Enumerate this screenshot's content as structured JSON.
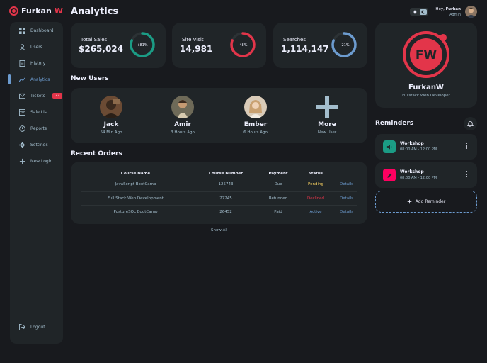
{
  "brand": {
    "name": "Furkan",
    "accent": "W"
  },
  "sidebar": {
    "items": [
      {
        "label": "Dashboard",
        "icon": "grid-icon"
      },
      {
        "label": "Users",
        "icon": "user-icon"
      },
      {
        "label": "History",
        "icon": "receipt-icon"
      },
      {
        "label": "Analytics",
        "icon": "chart-icon",
        "active": true
      },
      {
        "label": "Tickets",
        "icon": "mail-icon",
        "badge": "27"
      },
      {
        "label": "Sale List",
        "icon": "inventory-icon"
      },
      {
        "label": "Reports",
        "icon": "report-icon"
      },
      {
        "label": "Settings",
        "icon": "gear-icon"
      },
      {
        "label": "New Login",
        "icon": "plus-icon"
      }
    ],
    "logout": "Logout"
  },
  "page": {
    "title": "Analytics"
  },
  "stats": [
    {
      "label": "Total Sales",
      "value": "$265,024",
      "percent_label": "+81%",
      "percent": 81,
      "color": "#1b9c85"
    },
    {
      "label": "Site Visit",
      "value": "14,981",
      "percent_label": "-48%",
      "percent": 81,
      "color": "#e3354a"
    },
    {
      "label": "Searches",
      "value": "1,114,147",
      "percent_label": "+21%",
      "percent": 81,
      "color": "#6c9bcf"
    }
  ],
  "new_users": {
    "title": "New Users",
    "users": [
      {
        "name": "Jack",
        "time": "54 Min Ago"
      },
      {
        "name": "Amir",
        "time": "3 Hours Ago"
      },
      {
        "name": "Ember",
        "time": "6 Hours Ago"
      },
      {
        "name": "More",
        "time": "New User"
      }
    ]
  },
  "orders": {
    "title": "Recent Orders",
    "headers": [
      "Course Name",
      "Course Number",
      "Payment",
      "Status"
    ],
    "rows": [
      {
        "name": "JavaScript BootCamp",
        "number": "125743",
        "payment": "Due",
        "status": "Pending",
        "action": "Details"
      },
      {
        "name": "Full Stack Web Development",
        "number": "27245",
        "payment": "Refunded",
        "status": "Declined",
        "action": "Details"
      },
      {
        "name": "PostgreSQL BootCamp",
        "number": "26452",
        "payment": "Paid",
        "status": "Active",
        "action": "Details"
      }
    ],
    "show_all": "Show All"
  },
  "header": {
    "greeting": "Hey,",
    "user": "Furkan",
    "role": "Admin"
  },
  "profile": {
    "logo_text": "FW",
    "name": "FurkanW",
    "role": "Fullstack Web Developer"
  },
  "reminders": {
    "title": "Reminders",
    "items": [
      {
        "title": "Workshop",
        "time": "08:00 AM - 12:00 PM",
        "icon": "volume-icon",
        "color": "#1b9c85"
      },
      {
        "title": "Workshop",
        "time": "08:00 AM - 12:00 PM",
        "icon": "edit-icon",
        "color": "#ff0060"
      }
    ],
    "add_label": "Add Reminder"
  },
  "colors": {
    "primary": "#6c9bcf",
    "danger": "#e3354a",
    "success": "#1b9c85",
    "warning": "#f7d060"
  }
}
